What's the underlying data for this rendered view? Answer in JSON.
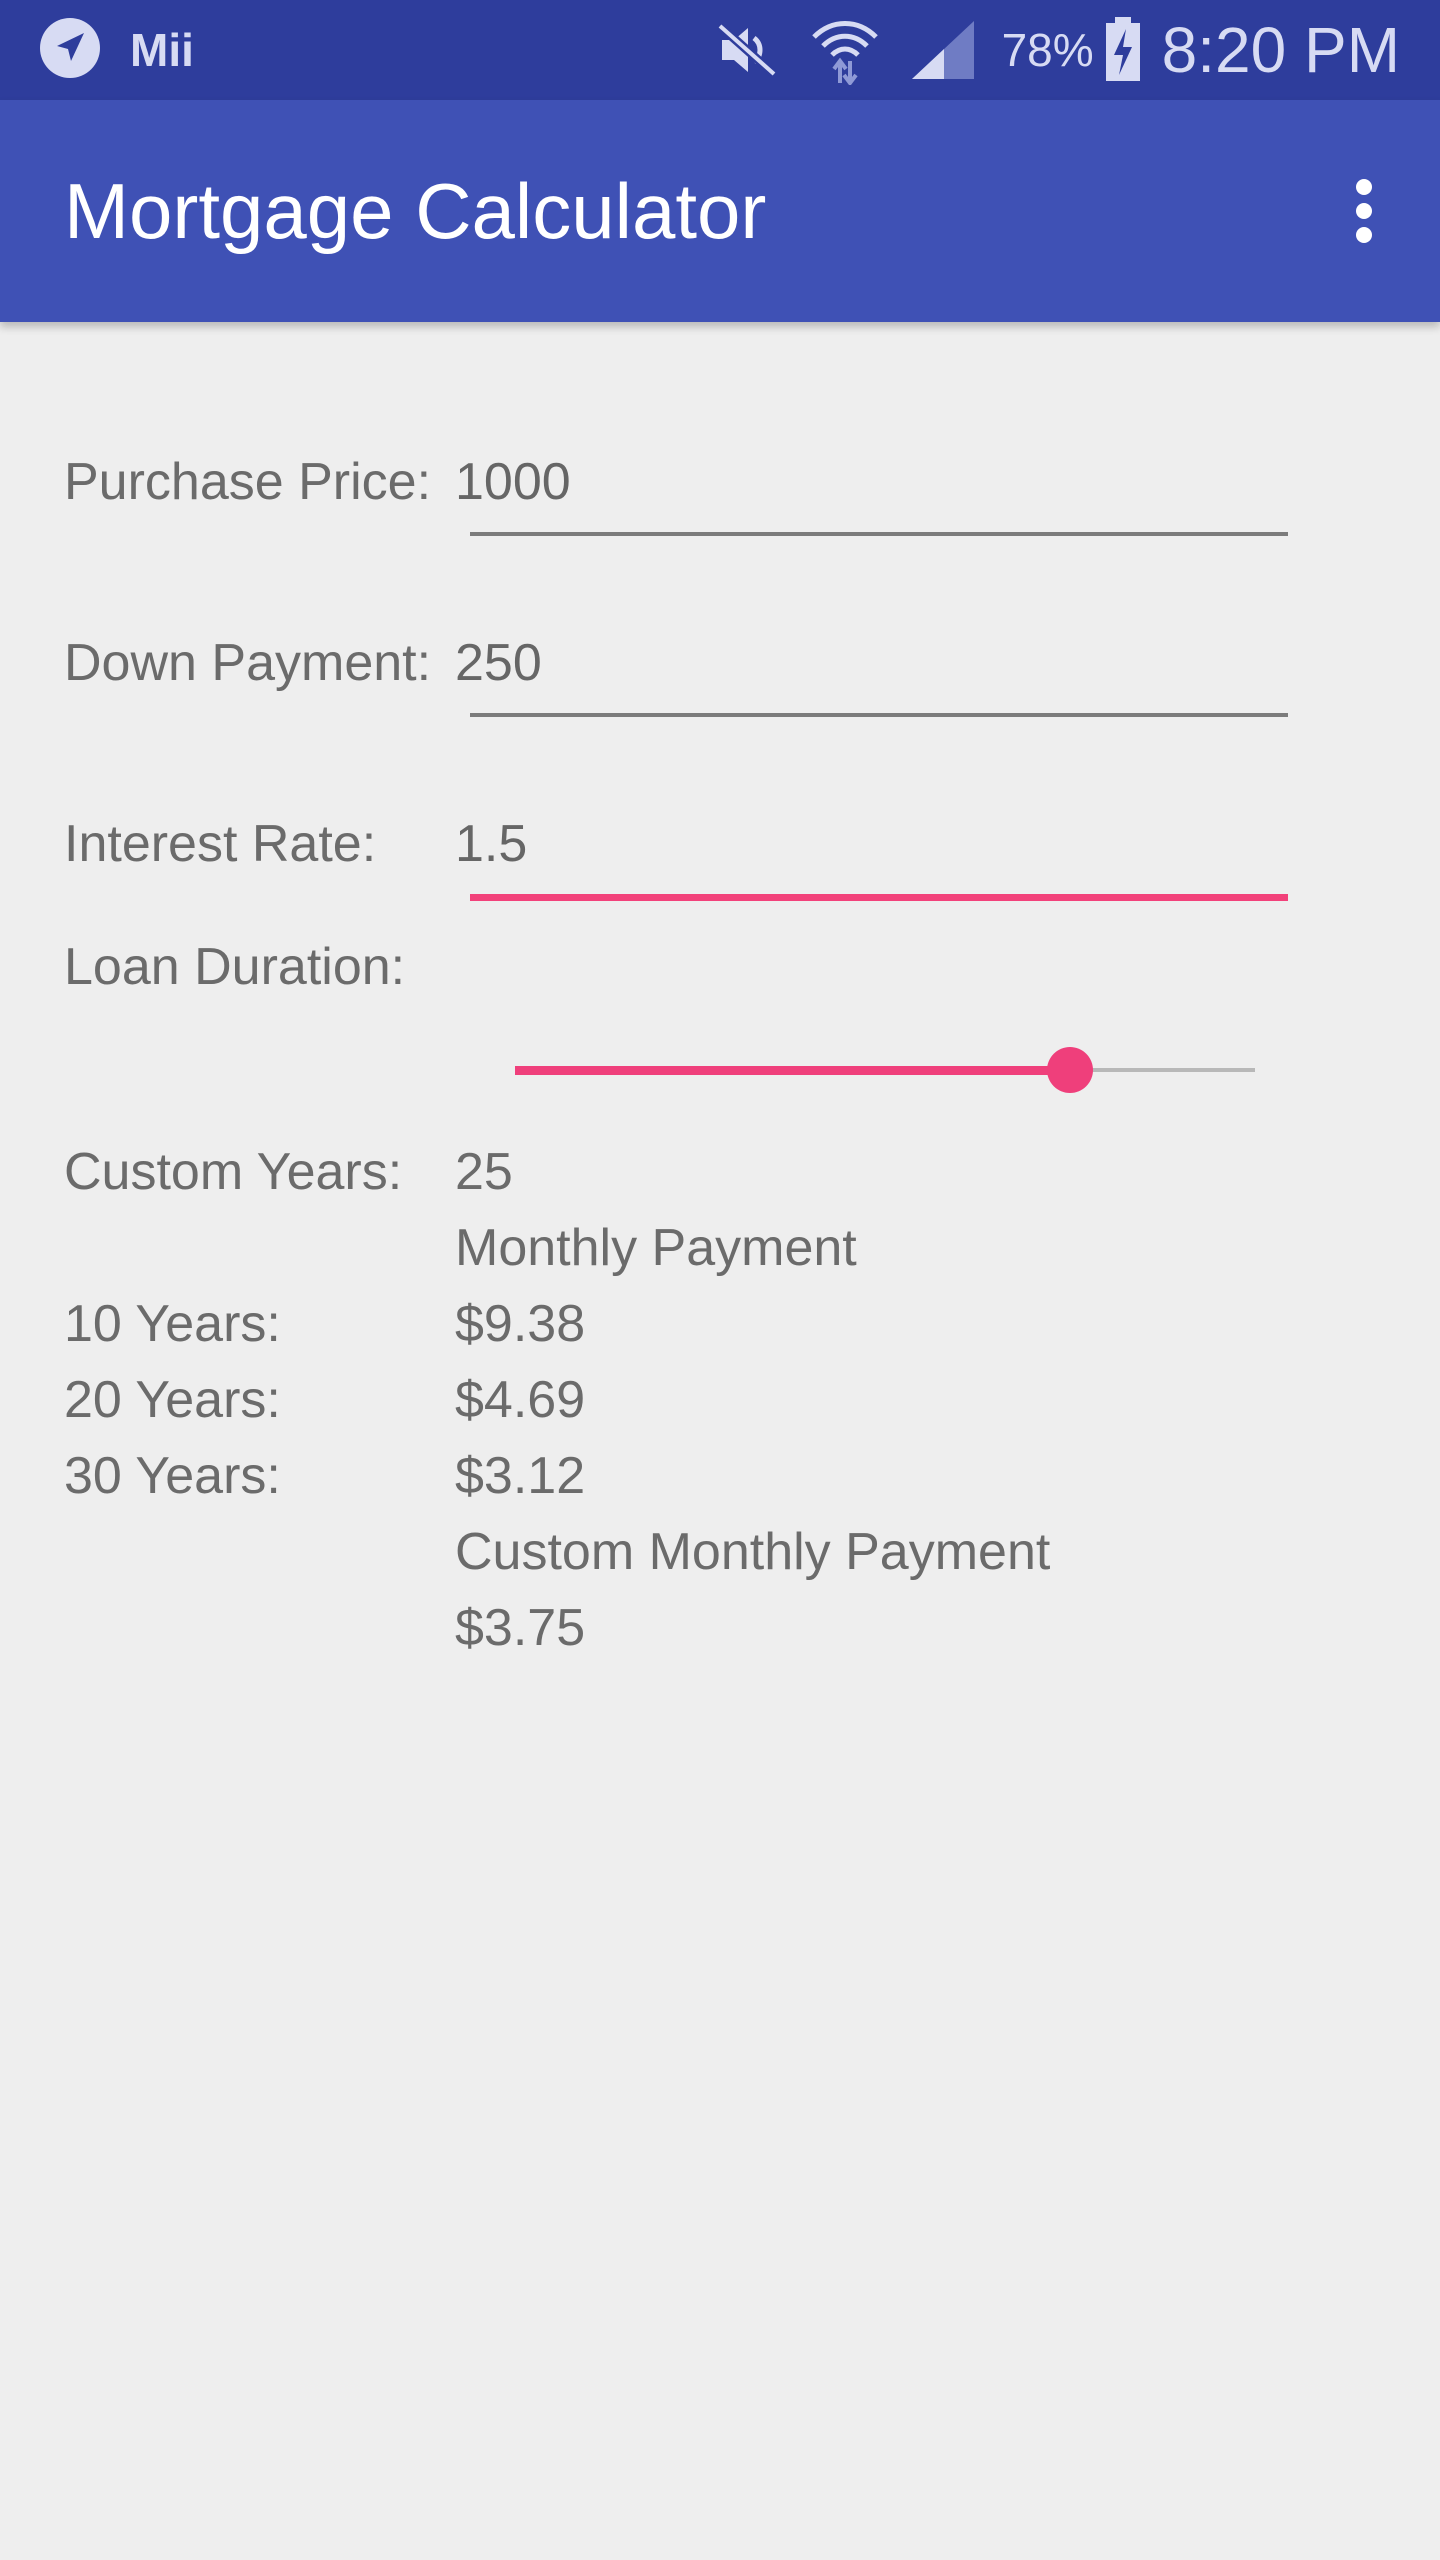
{
  "status_bar": {
    "app_notification": "Mii",
    "battery_percent": "78%",
    "time": "8:20 PM",
    "icons": [
      "navigation-arrow-icon",
      "mute-icon",
      "wifi-icon",
      "cell-signal-icon",
      "battery-charging-icon"
    ]
  },
  "app_bar": {
    "title": "Mortgage Calculator",
    "menu_icon": "more-vert-icon"
  },
  "form": {
    "purchase_price": {
      "label": "Purchase Price:",
      "value": "1000"
    },
    "down_payment": {
      "label": "Down Payment:",
      "value": "250"
    },
    "interest_rate": {
      "label": "Interest Rate:",
      "value": "1.5"
    },
    "loan_duration": {
      "label": "Loan Duration:",
      "slider_level": 0.75
    }
  },
  "results": {
    "custom_years_label": "Custom Years:",
    "custom_years_value": "25",
    "monthly_payment_heading": "Monthly Payment",
    "rows": [
      {
        "label": "10 Years:",
        "value": "$9.38"
      },
      {
        "label": "20 Years:",
        "value": "$4.69"
      },
      {
        "label": "30 Years:",
        "value": "$3.12"
      }
    ],
    "custom_monthly_heading": "Custom Monthly Payment",
    "custom_monthly_value": "$3.75"
  },
  "colors": {
    "status_bar": "#2e3d9c",
    "app_bar": "#3f51b5",
    "accent": "#ef3f7b",
    "background": "#eeeeee"
  }
}
